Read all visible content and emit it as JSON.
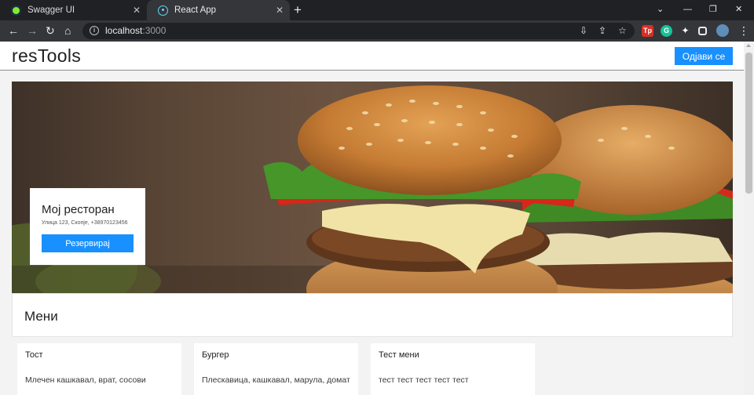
{
  "browser": {
    "tabs": [
      {
        "title": "Swagger UI",
        "active": false
      },
      {
        "title": "React App",
        "active": true
      }
    ],
    "url_host": "localhost",
    "url_port": ":3000",
    "icons": [
      "back-icon",
      "forward-icon",
      "reload-icon",
      "home-icon",
      "info-icon",
      "install-icon",
      "share-icon",
      "bookmark-star-icon",
      "extensions-icon",
      "sidepanel-icon",
      "profile-avatar",
      "menu-kebab-icon"
    ]
  },
  "app": {
    "logo": "resTools",
    "logout_label": "Одјави се",
    "accent_color": "#1890ff"
  },
  "restaurant": {
    "name": "Мој ресторан",
    "address": "Улица 123, Скопје, +38970123456",
    "reserve_label": "Резервирај"
  },
  "menu": {
    "title": "Мени",
    "items": [
      {
        "name": "Тост",
        "description": "Млечен кашкавал, врат, сосови"
      },
      {
        "name": "Бургер",
        "description": "Плескавица, кашкавал, марула, домат"
      },
      {
        "name": "Тест мени",
        "description": "тест тест тест тест тест"
      }
    ]
  }
}
